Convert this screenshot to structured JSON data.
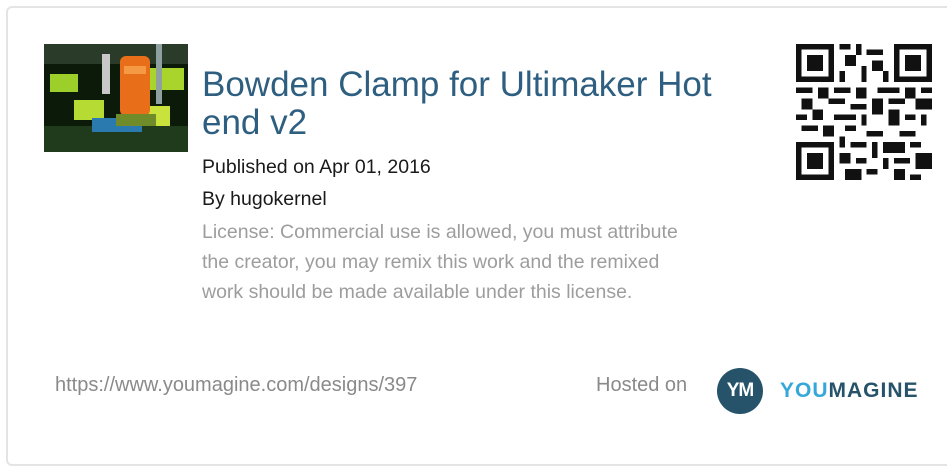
{
  "design": {
    "title": "Bowden Clamp for Ultimaker Hot end v2",
    "published": "Published on Apr 01, 2016",
    "author": "By hugokernel",
    "license": "License: Commercial use is allowed, you must attribute the creator, you may remix this work and the remixed work should be made available under this license."
  },
  "footer": {
    "url": "https://www.youmagine.com/designs/397",
    "hosted_label": "Hosted on",
    "logo_mark": "YM",
    "brand_part1": "YOU",
    "brand_part2": "MAGINE"
  },
  "colors": {
    "title": "#2e5f80",
    "license": "#9d9d9d",
    "brand_light": "#35a8d9",
    "brand_dark": "#26536a"
  },
  "icons": {
    "thumbnail": "3d-print-photo",
    "qr": "qr-code-icon"
  }
}
